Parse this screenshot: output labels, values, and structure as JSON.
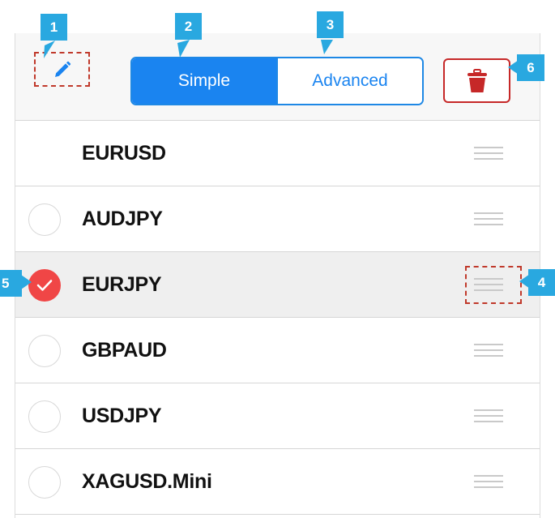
{
  "toolbar": {
    "edit_icon": "pencil-icon",
    "segments": [
      {
        "label": "Simple",
        "active": true
      },
      {
        "label": "Advanced",
        "active": false
      }
    ],
    "trash_icon": "trash-icon"
  },
  "symbols": [
    {
      "name": "EURUSD",
      "radio": "none"
    },
    {
      "name": "AUDJPY",
      "radio": "unchecked"
    },
    {
      "name": "EURJPY",
      "radio": "checked"
    },
    {
      "name": "GBPAUD",
      "radio": "unchecked"
    },
    {
      "name": "USDJPY",
      "radio": "unchecked"
    },
    {
      "name": "XAGUSD.Mini",
      "radio": "unchecked"
    }
  ],
  "callouts": {
    "c1": "1",
    "c2": "2",
    "c3": "3",
    "c4": "4",
    "c5": "5",
    "c6": "6"
  },
  "colors": {
    "accent_blue": "#1a84f0",
    "delete_red": "#c62828",
    "check_red": "#f04646",
    "callout_blue": "#29a8e0",
    "annotation_dashed": "#c0392b"
  }
}
